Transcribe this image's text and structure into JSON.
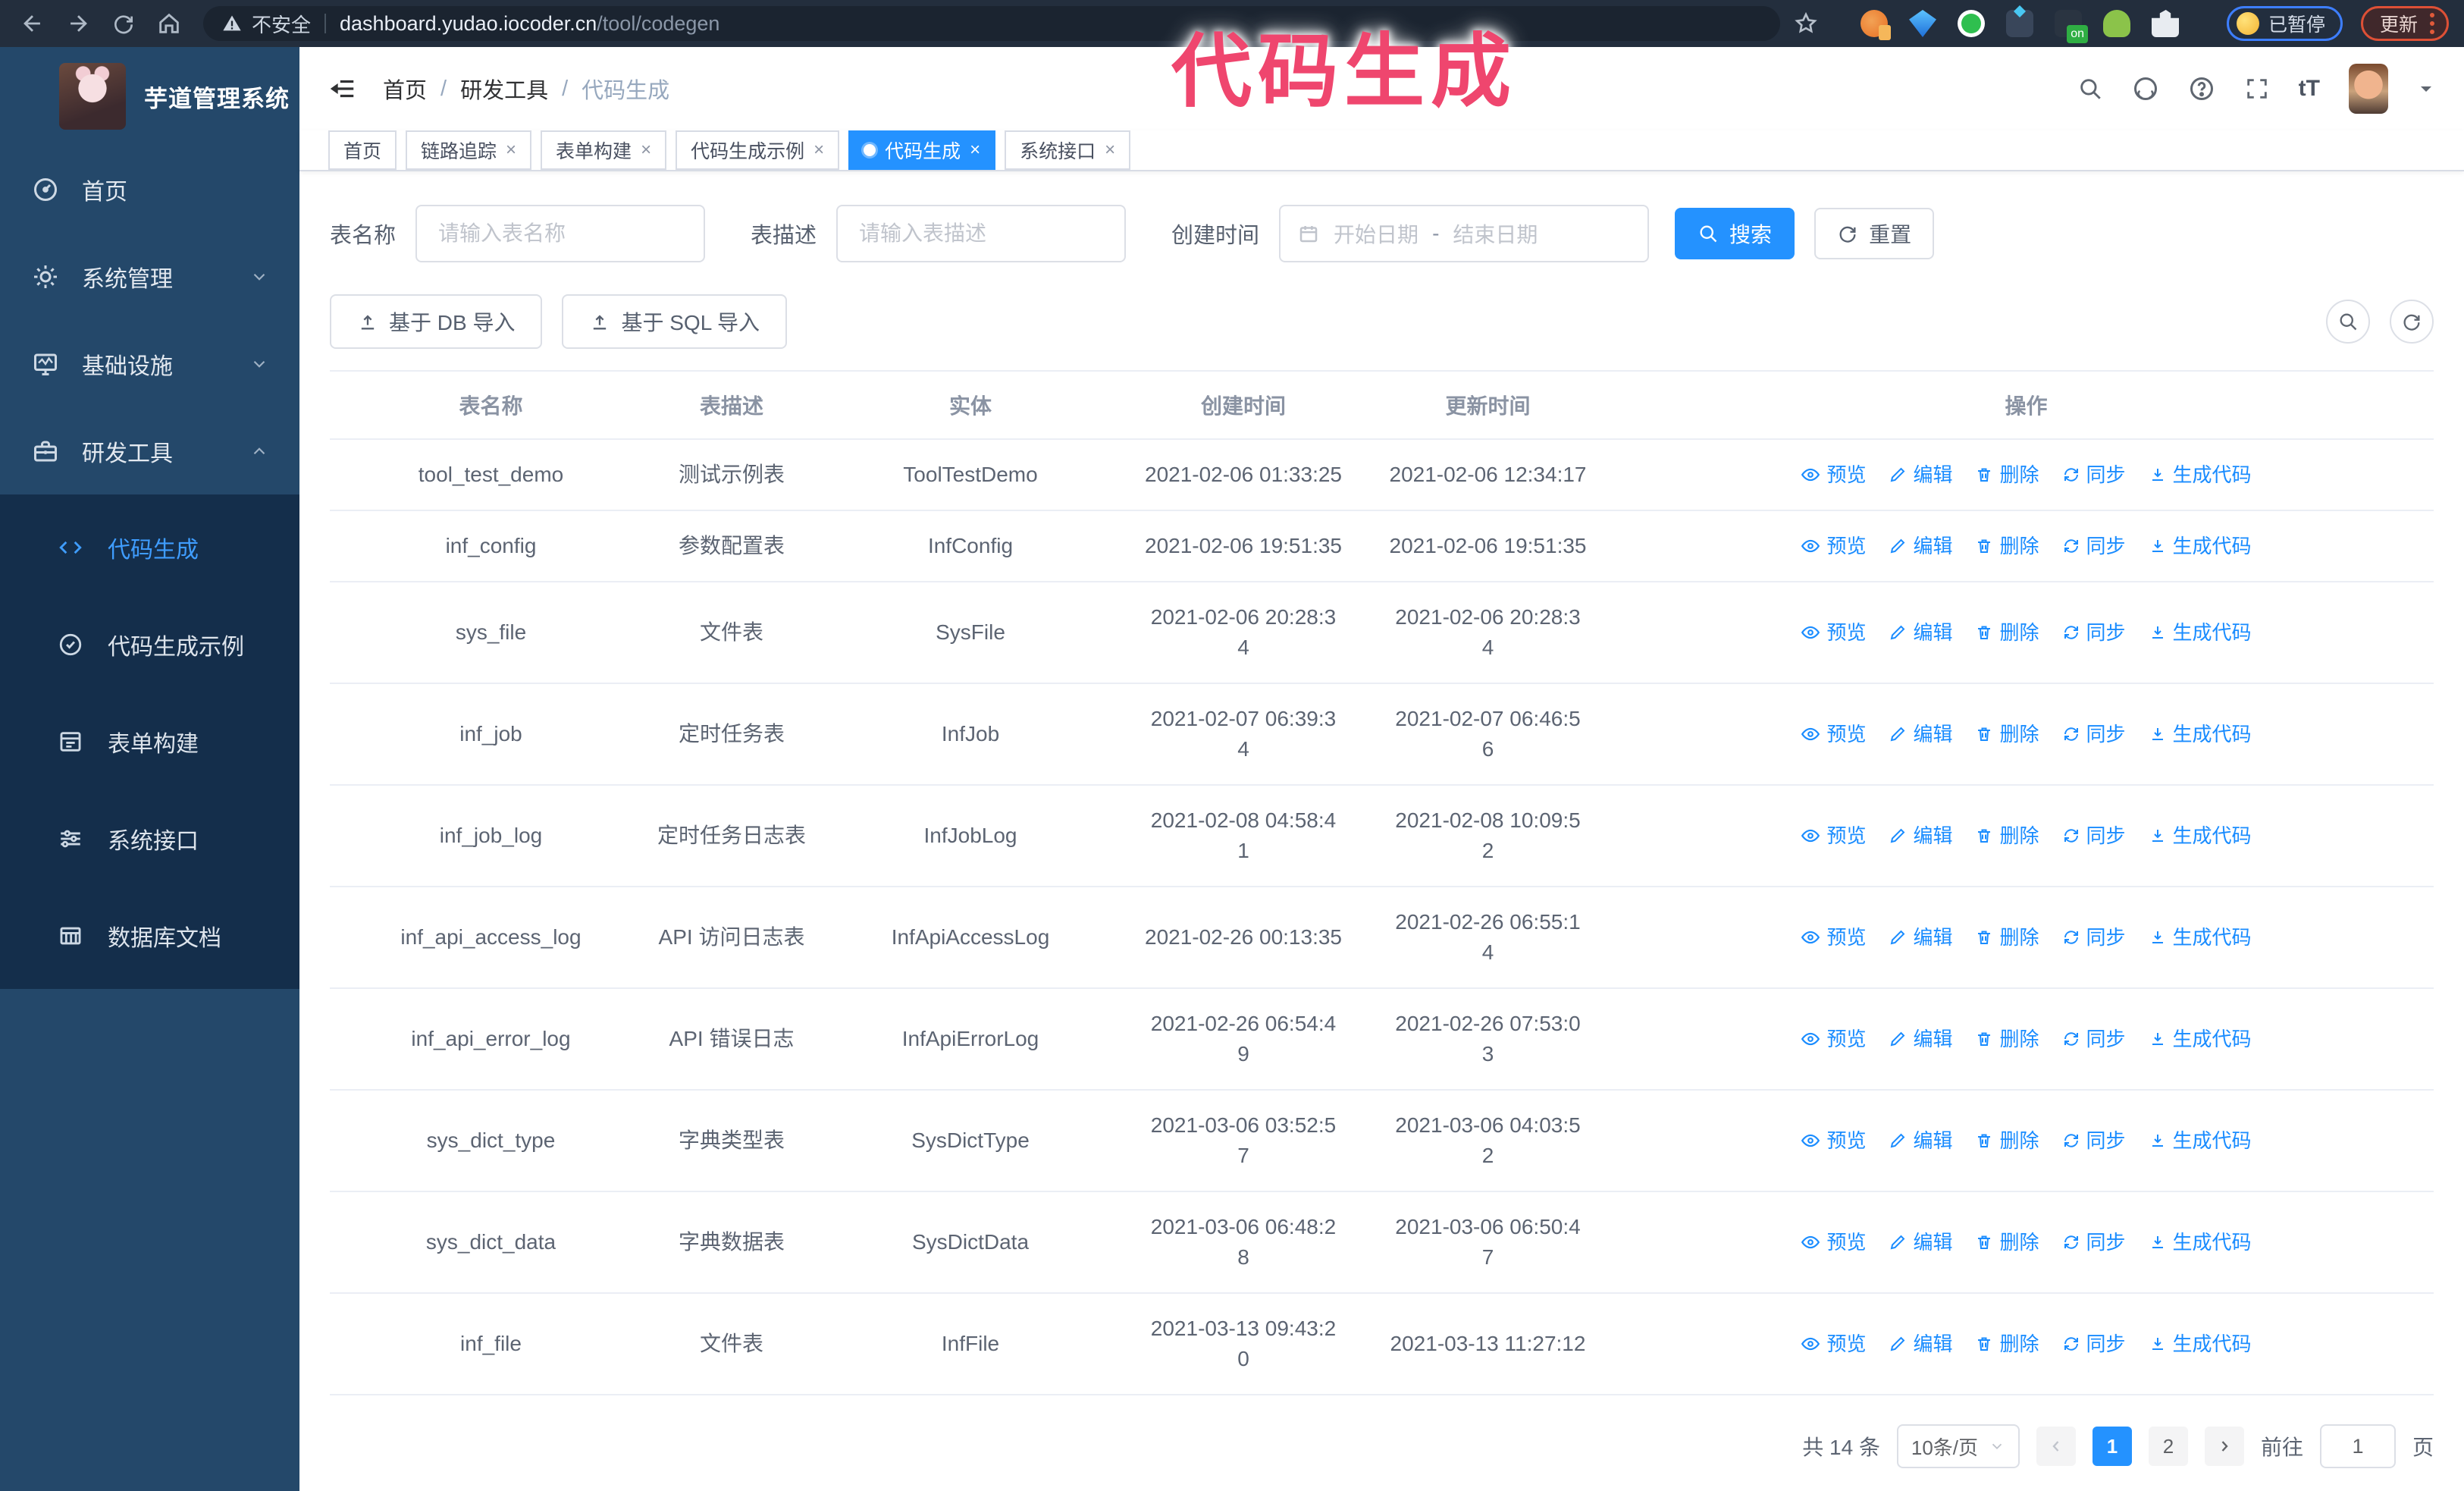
{
  "browser": {
    "security_label": "不安全",
    "url_host": "dashboard.yudao.iocoder.cn",
    "url_path": "/tool/codegen",
    "paused_label": "已暂停",
    "update_label": "更新"
  },
  "annotation": {
    "text": "代码生成",
    "color": "#ef466e"
  },
  "sidebar": {
    "title": "芋道管理系统",
    "items": [
      {
        "label": "首页"
      },
      {
        "label": "系统管理"
      },
      {
        "label": "基础设施"
      },
      {
        "label": "研发工具"
      }
    ],
    "subitems": [
      {
        "label": "代码生成"
      },
      {
        "label": "代码生成示例"
      },
      {
        "label": "表单构建"
      },
      {
        "label": "系统接口"
      },
      {
        "label": "数据库文档"
      }
    ]
  },
  "breadcrumb": [
    "首页",
    "研发工具",
    "代码生成"
  ],
  "tabs": [
    {
      "label": "首页"
    },
    {
      "label": "链路追踪"
    },
    {
      "label": "表单构建"
    },
    {
      "label": "代码生成示例"
    },
    {
      "label": "代码生成"
    },
    {
      "label": "系统接口"
    }
  ],
  "filters": {
    "name_label": "表名称",
    "name_placeholder": "请输入表名称",
    "desc_label": "表描述",
    "desc_placeholder": "请输入表描述",
    "time_label": "创建时间",
    "start_placeholder": "开始日期",
    "range_separator": "-",
    "end_placeholder": "结束日期",
    "search_label": "搜索",
    "reset_label": "重置"
  },
  "toolbar": {
    "import_db": "基于 DB 导入",
    "import_sql": "基于 SQL 导入"
  },
  "table": {
    "columns": [
      "表名称",
      "表描述",
      "实体",
      "创建时间",
      "更新时间",
      "操作"
    ],
    "actions": [
      "预览",
      "编辑",
      "删除",
      "同步",
      "生成代码"
    ],
    "rows": [
      {
        "name": "tool_test_demo",
        "desc": "测试示例表",
        "entity": "ToolTestDemo",
        "created": "2021-02-06 01:33:25",
        "updated": "2021-02-06 12:34:17"
      },
      {
        "name": "inf_config",
        "desc": "参数配置表",
        "entity": "InfConfig",
        "created": "2021-02-06 19:51:35",
        "updated": "2021-02-06 19:51:35"
      },
      {
        "name": "sys_file",
        "desc": "文件表",
        "entity": "SysFile",
        "created": "2021-02-06 20:28:3\n4",
        "updated": "2021-02-06 20:28:3\n4"
      },
      {
        "name": "inf_job",
        "desc": "定时任务表",
        "entity": "InfJob",
        "created": "2021-02-07 06:39:3\n4",
        "updated": "2021-02-07 06:46:5\n6"
      },
      {
        "name": "inf_job_log",
        "desc": "定时任务日志表",
        "entity": "InfJobLog",
        "created": "2021-02-08 04:58:4\n1",
        "updated": "2021-02-08 10:09:5\n2"
      },
      {
        "name": "inf_api_access_log",
        "desc": "API 访问日志表",
        "entity": "InfApiAccessLog",
        "created": "2021-02-26 00:13:35",
        "updated": "2021-02-26 06:55:1\n4"
      },
      {
        "name": "inf_api_error_log",
        "desc": "API 错误日志",
        "entity": "InfApiErrorLog",
        "created": "2021-02-26 06:54:4\n9",
        "updated": "2021-02-26 07:53:0\n3"
      },
      {
        "name": "sys_dict_type",
        "desc": "字典类型表",
        "entity": "SysDictType",
        "created": "2021-03-06 03:52:5\n7",
        "updated": "2021-03-06 04:03:5\n2"
      },
      {
        "name": "sys_dict_data",
        "desc": "字典数据表",
        "entity": "SysDictData",
        "created": "2021-03-06 06:48:2\n8",
        "updated": "2021-03-06 06:50:4\n7"
      },
      {
        "name": "inf_file",
        "desc": "文件表",
        "entity": "InfFile",
        "created": "2021-03-13 09:43:2\n0",
        "updated": "2021-03-13 11:27:12"
      }
    ]
  },
  "pagination": {
    "total": "共 14 条",
    "page_size": "10条/页",
    "pages": [
      "1",
      "2"
    ],
    "goto_label": "前往",
    "goto_value": "1",
    "goto_unit": "页"
  }
}
